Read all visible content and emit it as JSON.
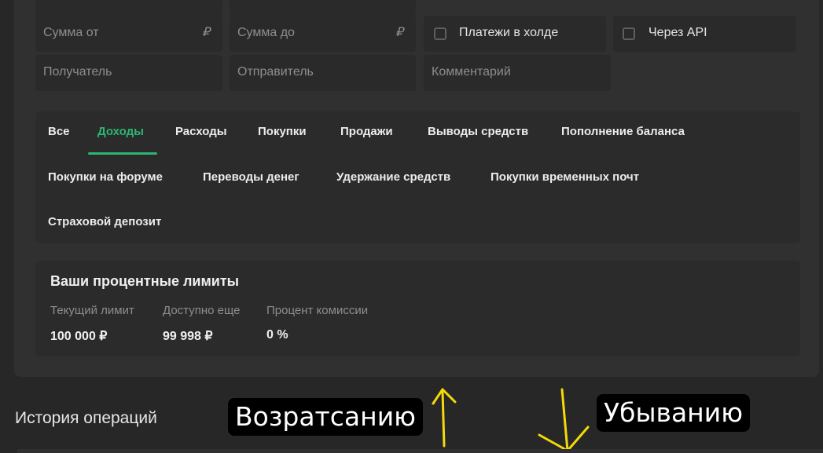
{
  "filters": {
    "sum_from": {
      "placeholder": "Сумма от",
      "currency": "₽"
    },
    "sum_to": {
      "placeholder": "Сумма до",
      "currency": "₽"
    },
    "hold_label": "Платежи в холде",
    "api_label": "Через API",
    "recipient_placeholder": "Получатель",
    "sender_placeholder": "Отправитель",
    "comment_placeholder": "Комментарий"
  },
  "tabs": [
    {
      "label": "Все",
      "active": false
    },
    {
      "label": "Доходы",
      "active": true
    },
    {
      "label": "Расходы",
      "active": false
    },
    {
      "label": "Покупки",
      "active": false
    },
    {
      "label": "Продажи",
      "active": false
    },
    {
      "label": "Выводы средств",
      "active": false
    },
    {
      "label": "Пополнение баланса",
      "active": false
    },
    {
      "label": "Покупки на форуме",
      "active": false
    },
    {
      "label": "Переводы денег",
      "active": false
    },
    {
      "label": "Удержание средств",
      "active": false
    },
    {
      "label": "Покупки временных почт",
      "active": false
    },
    {
      "label": "Страховой депозит",
      "active": false
    }
  ],
  "limits": {
    "title": "Ваши процентные лимиты",
    "current_label": "Текущий лимит",
    "current_value": "100 000 ₽",
    "available_label": "Доступно еще",
    "available_value": "99 998 ₽",
    "commission_label": "Процент комиссии",
    "commission_value": "0 %"
  },
  "history_title": "История операций",
  "annotations": {
    "ascending": "Возратсанию",
    "descending": "Убыванию",
    "arrow_color": "#f5d90a"
  },
  "colors": {
    "accent": "#2bb673",
    "background": "#272727",
    "panel": "#303030"
  }
}
